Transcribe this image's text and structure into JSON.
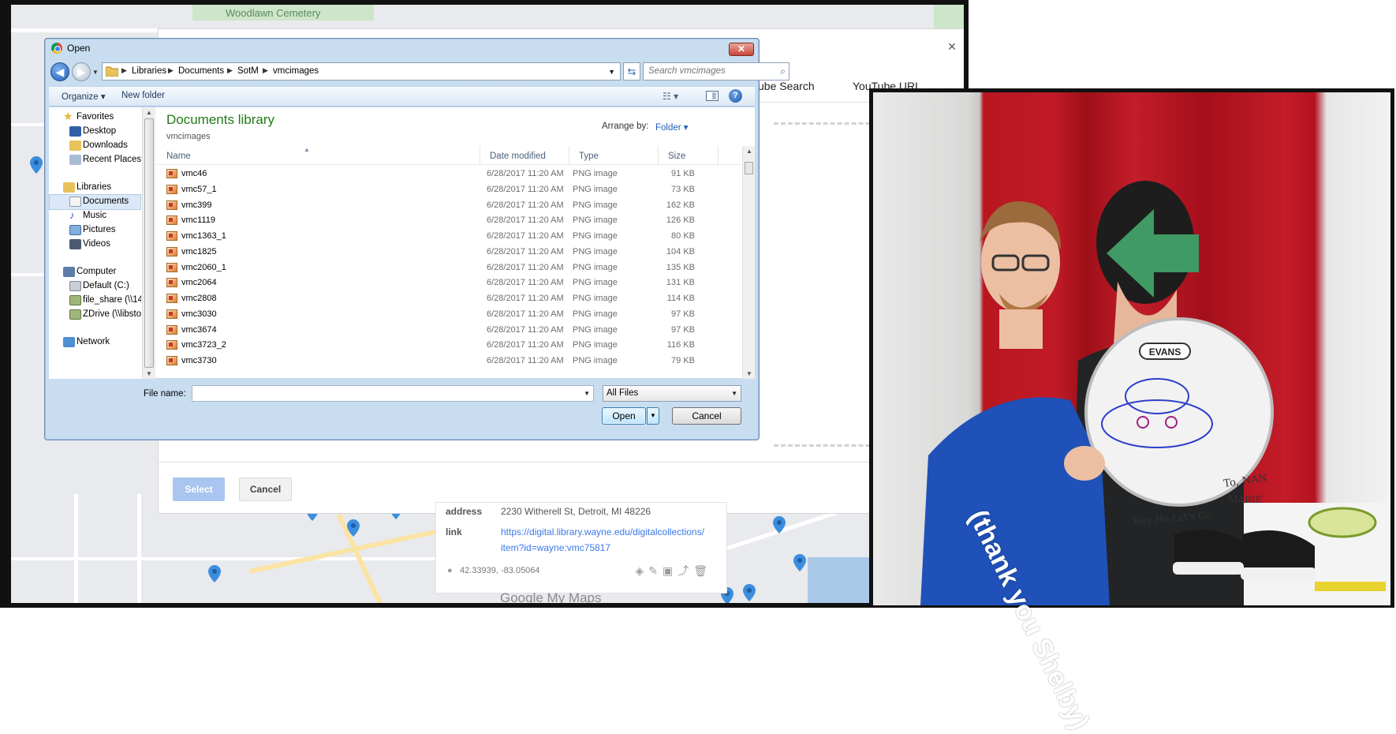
{
  "map": {
    "cemetery_label": "Woodlawn Cemetery",
    "logo": "Google My Maps",
    "info_card": {
      "address_key": "address",
      "address_val": "2230 Witherell St, Detroit, MI 48226",
      "link_key": "link",
      "link_line1": "https://digital.library.wayne.edu/digitalcollections/",
      "link_line2": "item?id=wayne:vmc75817",
      "coords": "42.33939, -83.05064"
    }
  },
  "picker": {
    "close_icon": "×",
    "tab_search": "ube Search",
    "tab_url": "YouTube URL",
    "select_label": "Select",
    "cancel_label": "Cancel"
  },
  "dialog": {
    "title": "Open",
    "close_label": "✕",
    "breadcrumbs": [
      "Libraries",
      "Documents",
      "SotM",
      "vmcimages"
    ],
    "search_placeholder": "Search vmcimages",
    "toolbar": {
      "organize": "Organize ▾",
      "new_folder": "New folder"
    },
    "nav": {
      "favorites": "Favorites",
      "desktop": "Desktop",
      "downloads": "Downloads",
      "recent": "Recent Places",
      "libraries": "Libraries",
      "documents": "Documents",
      "music": "Music",
      "pictures": "Pictures",
      "videos": "Videos",
      "computer": "Computer",
      "drive_c": "Default (C:)",
      "file_share": "file_share (\\\\141.2",
      "zdrive": "ZDrive (\\\\libstor)",
      "network": "Network"
    },
    "library_title": "Documents library",
    "library_sub": "vmcimages",
    "arrange_label": "Arrange by:",
    "arrange_value": "Folder ▾",
    "columns": {
      "name": "Name",
      "date": "Date modified",
      "type": "Type",
      "size": "Size"
    },
    "files": [
      {
        "name": "vmc46",
        "date": "6/28/2017 11:20 AM",
        "type": "PNG image",
        "size": "91 KB"
      },
      {
        "name": "vmc57_1",
        "date": "6/28/2017 11:20 AM",
        "type": "PNG image",
        "size": "73 KB"
      },
      {
        "name": "vmc399",
        "date": "6/28/2017 11:20 AM",
        "type": "PNG image",
        "size": "162 KB"
      },
      {
        "name": "vmc1119",
        "date": "6/28/2017 11:20 AM",
        "type": "PNG image",
        "size": "126 KB"
      },
      {
        "name": "vmc1363_1",
        "date": "6/28/2017 11:20 AM",
        "type": "PNG image",
        "size": "80 KB"
      },
      {
        "name": "vmc1825",
        "date": "6/28/2017 11:20 AM",
        "type": "PNG image",
        "size": "104 KB"
      },
      {
        "name": "vmc2060_1",
        "date": "6/28/2017 11:20 AM",
        "type": "PNG image",
        "size": "135 KB"
      },
      {
        "name": "vmc2064",
        "date": "6/28/2017 11:20 AM",
        "type": "PNG image",
        "size": "131 KB"
      },
      {
        "name": "vmc2808",
        "date": "6/28/2017 11:20 AM",
        "type": "PNG image",
        "size": "114 KB"
      },
      {
        "name": "vmc3030",
        "date": "6/28/2017 11:20 AM",
        "type": "PNG image",
        "size": "97 KB"
      },
      {
        "name": "vmc3674",
        "date": "6/28/2017 11:20 AM",
        "type": "PNG image",
        "size": "97 KB"
      },
      {
        "name": "vmc3723_2",
        "date": "6/28/2017 11:20 AM",
        "type": "PNG image",
        "size": "116 KB"
      },
      {
        "name": "vmc3730",
        "date": "6/28/2017 11:20 AM",
        "type": "PNG image",
        "size": "79 KB"
      }
    ],
    "filename_label": "File name:",
    "filename_value": "",
    "filetype_value": "All Files",
    "open_label": "Open",
    "cancel_label": "Cancel"
  },
  "photo": {
    "caption": "(thank you Shelby)",
    "drum_brand": "EVANS",
    "drum_to": "To, NAN",
    "drum_name": "MARIE",
    "drum_sign": "Hey Ho Let's Go",
    "arrow_color": "#3f9a63"
  },
  "colors": {
    "dialog_frame": "#c9ddf1",
    "library_title": "#1e7b14",
    "link": "#3b78e7"
  }
}
